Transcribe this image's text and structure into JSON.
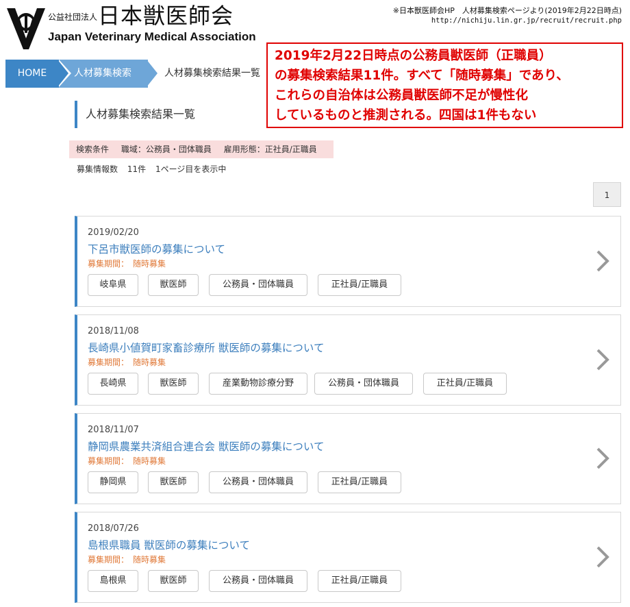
{
  "header": {
    "org_type": "公益社団法人",
    "org_name": "日本獣医師会",
    "org_name_en": "Japan Veterinary Medical Association",
    "source_note": "※日本獣医師会HP　人材募集検索ページより(2019年2月22日時点)",
    "source_url": "http://nichiju.lin.gr.jp/recruit/recruit.php"
  },
  "breadcrumb": {
    "home": "HOME",
    "search": "人材募集検索",
    "current": "人材募集検索結果一覧"
  },
  "annotation": {
    "lines": [
      "2019年2月22日時点の公務員獣医師（正職員）",
      "の募集検索結果11件。すべて「随時募集」であり、",
      "これらの自治体は公務員獣医師不足が慢性化",
      "しているものと推測される。四国は1件もない"
    ]
  },
  "page_title": "人材募集検索結果一覧",
  "conditions": {
    "label": "検索条件",
    "field": "職域：公務員・団体職員",
    "employment": "雇用形態：正社員/正職員"
  },
  "results": {
    "label": "募集情報数",
    "count": "11件",
    "page_info": "1ページ目を表示中"
  },
  "pagination": {
    "current": "1"
  },
  "colors": {
    "accent": "#3d86c6",
    "period": "#e07a3a",
    "annotation": "#e00000",
    "condition_bg": "#f9dddd"
  },
  "cards": [
    {
      "date": "2019/02/20",
      "title": "下呂市獣医師の募集について",
      "period_label": "募集期間：",
      "period_value": "随時募集",
      "tags": [
        "岐阜県",
        "獣医師",
        "公務員・団体職員",
        "正社員/正職員"
      ]
    },
    {
      "date": "2018/11/08",
      "title": "長崎県小値賀町家畜診療所 獣医師の募集について",
      "period_label": "募集期間：",
      "period_value": "随時募集",
      "tags": [
        "長崎県",
        "獣医師",
        "産業動物診療分野",
        "公務員・団体職員",
        "正社員/正職員"
      ]
    },
    {
      "date": "2018/11/07",
      "title": "静岡県農業共済組合連合会 獣医師の募集について",
      "period_label": "募集期間：",
      "period_value": "随時募集",
      "tags": [
        "静岡県",
        "獣医師",
        "公務員・団体職員",
        "正社員/正職員"
      ]
    },
    {
      "date": "2018/07/26",
      "title": "島根県職員 獣医師の募集について",
      "period_label": "募集期間：",
      "period_value": "随時募集",
      "tags": [
        "島根県",
        "獣医師",
        "公務員・団体職員",
        "正社員/正職員"
      ]
    }
  ]
}
